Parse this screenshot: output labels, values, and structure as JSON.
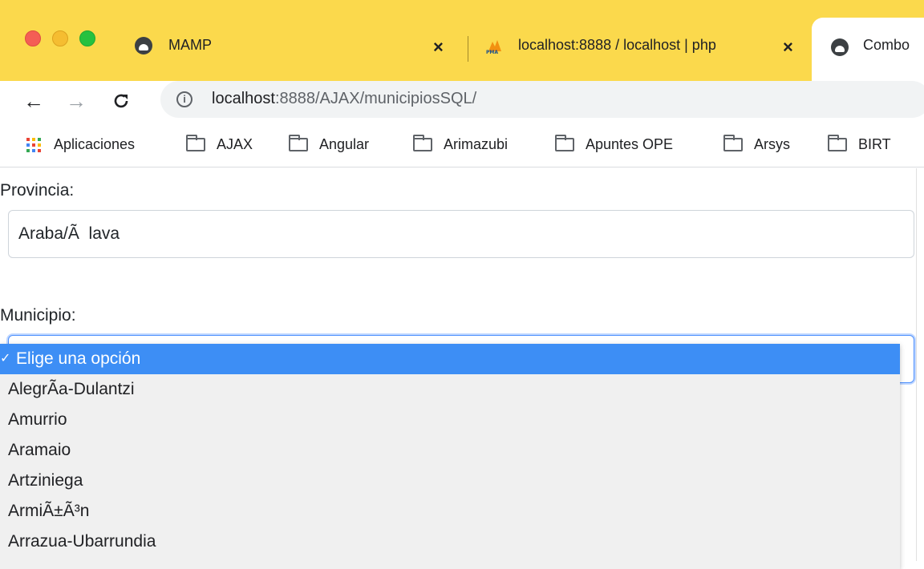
{
  "tabs": [
    {
      "title": "MAMP",
      "icon": "mamp-icon",
      "active": false
    },
    {
      "title": "localhost:8888 / localhost | php",
      "icon": "phpmyadmin-icon",
      "active": false
    },
    {
      "title": "Combo",
      "icon": "mamp-icon",
      "active": true
    }
  ],
  "toolbar": {
    "back_icon": "←",
    "forward_icon": "→",
    "reload_icon": "C",
    "info_icon": "i",
    "url_host": "localhost",
    "url_rest": ":8888/AJAX/municipiosSQL/"
  },
  "bookmarks": {
    "apps_label": "Aplicaciones",
    "folders": [
      "AJAX",
      "Angular",
      "Arimazubi",
      "Apuntes OPE",
      "Arsys",
      "BIRT"
    ]
  },
  "form": {
    "provincia_label": "Provincia:",
    "provincia_value": "Araba/Ã  lava",
    "municipio_label": "Municipio:",
    "municipio_value": "Elige una opción"
  },
  "dropdown": {
    "options": [
      "Elige una opción",
      "AlegrÃa-Dulantzi",
      "Amurrio",
      "Aramaio",
      "Artziniega",
      "ArmiÃ±Ã³n",
      "Arrazua-Ubarrundia"
    ],
    "selected_index": 0
  },
  "colors": {
    "tabstrip": "#fbd94c",
    "selection": "#3d8ef5",
    "focus": "#4d90fe"
  }
}
